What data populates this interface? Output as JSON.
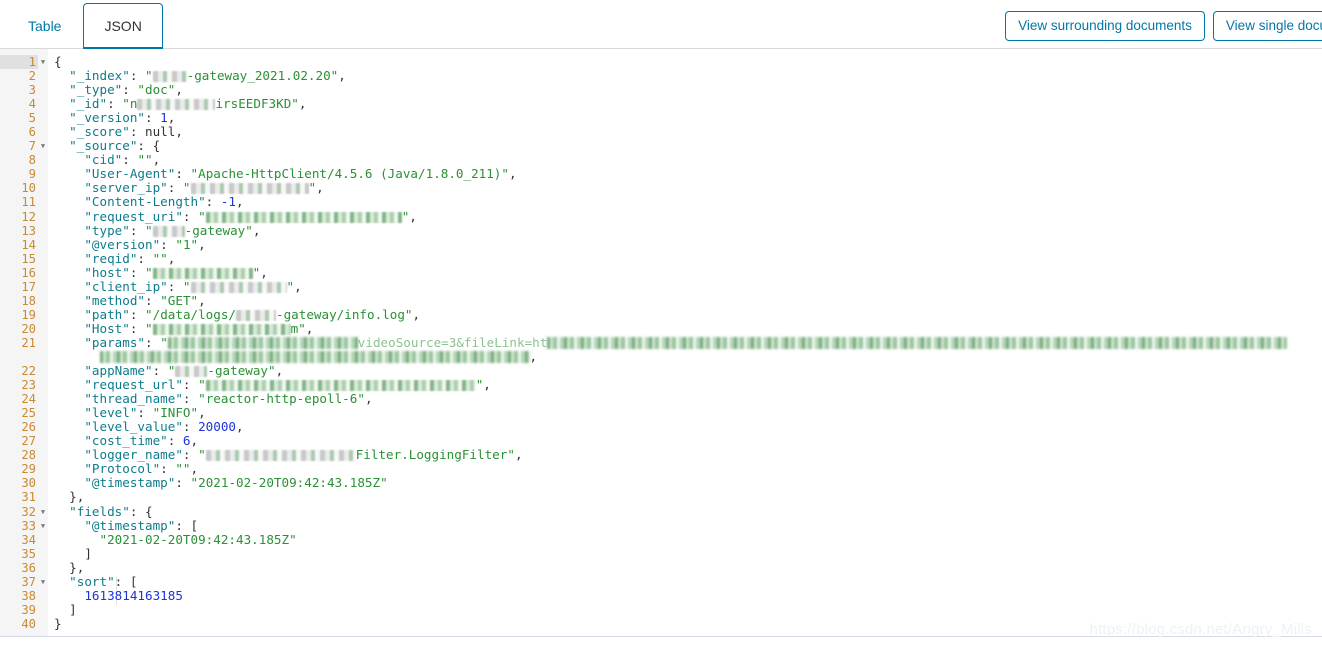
{
  "tabs": [
    {
      "id": "table",
      "label": "Table",
      "active": false
    },
    {
      "id": "json",
      "label": "JSON",
      "active": true
    }
  ],
  "actions": {
    "view_surrounding_label": "View surrounding documents",
    "view_single_label": "View single document"
  },
  "watermark": "https://blog.csdn.net/Angry_Mills",
  "colors": {
    "accent": "#0079a5",
    "key": "#0e7c8c",
    "string": "#2a9134",
    "number": "#1d34d8",
    "line_number": "#c98a32",
    "gutter_bg": "#f5f5f5"
  },
  "editor": {
    "language": "json",
    "total_lines": 40,
    "current_line": 1,
    "fold_lines": [
      1,
      7,
      32,
      33,
      37
    ],
    "lines": [
      {
        "n": 1,
        "text": "{"
      },
      {
        "n": 2,
        "text": "  \"_index\": \"[redacted]-gateway_2021.02.20\","
      },
      {
        "n": 3,
        "text": "  \"_type\": \"doc\","
      },
      {
        "n": 4,
        "text": "  \"_id\": \"n[redacted]irsEEDF3KD\","
      },
      {
        "n": 5,
        "text": "  \"_version\": 1,"
      },
      {
        "n": 6,
        "text": "  \"_score\": null,"
      },
      {
        "n": 7,
        "text": "  \"_source\": {"
      },
      {
        "n": 8,
        "text": "    \"cid\": \"\","
      },
      {
        "n": 9,
        "text": "    \"User-Agent\": \"Apache-HttpClient/4.5.6 (Java/1.8.0_211)\","
      },
      {
        "n": 10,
        "text": "    \"server_ip\": \"[redacted]\","
      },
      {
        "n": 11,
        "text": "    \"Content-Length\": -1,"
      },
      {
        "n": 12,
        "text": "    \"request_uri\": \"[redacted]\","
      },
      {
        "n": 13,
        "text": "    \"type\": \"[redacted]-gateway\","
      },
      {
        "n": 14,
        "text": "    \"@version\": \"1\","
      },
      {
        "n": 15,
        "text": "    \"reqid\": \"\","
      },
      {
        "n": 16,
        "text": "    \"host\": \"[redacted]\","
      },
      {
        "n": 17,
        "text": "    \"client_ip\": \"[redacted]\","
      },
      {
        "n": 18,
        "text": "    \"method\": \"GET\","
      },
      {
        "n": 19,
        "text": "    \"path\": \"/data/logs/[redacted]-gateway/info.log\","
      },
      {
        "n": 20,
        "text": "    \"Host\": \"[redacted].com\","
      },
      {
        "n": 21,
        "text": "    \"params\": \"[redacted]videoSource=3&fileLink=ht[redacted]\","
      },
      {
        "n": 22,
        "text": "    \"appName\": \"[redacted]-gateway\","
      },
      {
        "n": 23,
        "text": "    \"request_url\": \"[redacted]\","
      },
      {
        "n": 24,
        "text": "    \"thread_name\": \"reactor-http-epoll-6\","
      },
      {
        "n": 25,
        "text": "    \"level\": \"INFO\","
      },
      {
        "n": 26,
        "text": "    \"level_value\": 20000,"
      },
      {
        "n": 27,
        "text": "    \"cost_time\": 6,"
      },
      {
        "n": 28,
        "text": "    \"logger_name\": \"[redacted]filter.LoggingFilter\","
      },
      {
        "n": 29,
        "text": "    \"Protocol\": \"\","
      },
      {
        "n": 30,
        "text": "    \"@timestamp\": \"2021-02-20T09:42:43.185Z\""
      },
      {
        "n": 31,
        "text": "  },"
      },
      {
        "n": 32,
        "text": "  \"fields\": {"
      },
      {
        "n": 33,
        "text": "    \"@timestamp\": ["
      },
      {
        "n": 34,
        "text": "      \"2021-02-20T09:42:43.185Z\""
      },
      {
        "n": 35,
        "text": "    ]"
      },
      {
        "n": 36,
        "text": "  },"
      },
      {
        "n": 37,
        "text": "  \"sort\": ["
      },
      {
        "n": 38,
        "text": "    1613814163185"
      },
      {
        "n": 39,
        "text": "  ]"
      },
      {
        "n": 40,
        "text": "}"
      }
    ],
    "values": {
      "_index_suffix": "-gateway_2021.02.20",
      "_type": "doc",
      "_id_suffix": "irsEEDF3KD",
      "_id_prefix": "n",
      "_version": 1,
      "_score": "null",
      "cid": "",
      "user_agent": "Apache-HttpClient/4.5.6 (Java/1.8.0_211)",
      "content_length": -1,
      "type_suffix": "-gateway",
      "at_version": "1",
      "reqid": "",
      "method": "GET",
      "path_prefix": "/data/logs/",
      "path_suffix": "-gateway/info.log",
      "host_suffix": "m",
      "params_fragment": "videoSource=3&fileLink=ht",
      "appName_suffix": "-gateway",
      "thread_name": "reactor-http-epoll-6",
      "level": "INFO",
      "level_value": 20000,
      "cost_time": 6,
      "logger_name_suffix": "Filter.LoggingFilter",
      "protocol": "",
      "timestamp": "2021-02-20T09:42:43.185Z",
      "fields_timestamp": "2021-02-20T09:42:43.185Z",
      "sort_value": 1613814163185
    },
    "keys": {
      "_index": "\"_index\"",
      "_type": "\"_type\"",
      "_id": "\"_id\"",
      "_version": "\"_version\"",
      "_score": "\"_score\"",
      "_source": "\"_source\"",
      "cid": "\"cid\"",
      "user_agent": "\"User-Agent\"",
      "server_ip": "\"server_ip\"",
      "content_length": "\"Content-Length\"",
      "request_uri": "\"request_uri\"",
      "type": "\"type\"",
      "at_version": "\"@version\"",
      "reqid": "\"reqid\"",
      "host": "\"host\"",
      "client_ip": "\"client_ip\"",
      "method": "\"method\"",
      "path": "\"path\"",
      "Host": "\"Host\"",
      "params": "\"params\"",
      "appName": "\"appName\"",
      "request_url": "\"request_url\"",
      "thread_name": "\"thread_name\"",
      "level": "\"level\"",
      "level_value": "\"level_value\"",
      "cost_time": "\"cost_time\"",
      "logger_name": "\"logger_name\"",
      "Protocol": "\"Protocol\"",
      "timestamp": "\"@timestamp\"",
      "fields": "\"fields\"",
      "sort": "\"sort\""
    }
  }
}
